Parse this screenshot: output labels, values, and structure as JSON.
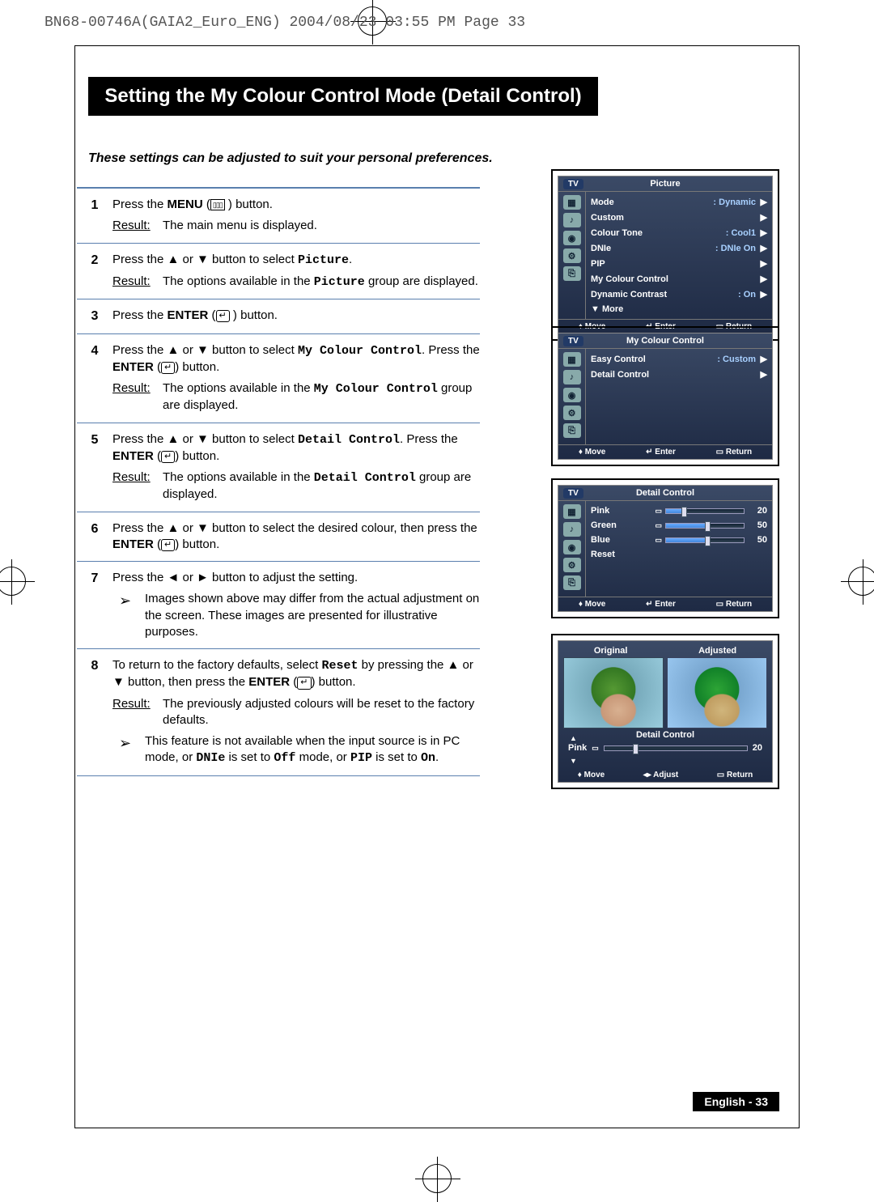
{
  "header_line": "BN68-00746A(GAIA2_Euro_ENG)  2004/08/23  03:55 PM  Page 33",
  "title": "Setting the My Colour Control Mode (Detail Control)",
  "intro": "These settings can be adjusted to suit your personal preferences.",
  "result_label": "Result:",
  "steps": {
    "1": {
      "n": "1",
      "text_a": "Press the ",
      "bold": "MENU",
      "text_b": " (",
      "text_c": " ) button.",
      "result": "The main menu is displayed."
    },
    "2": {
      "n": "2",
      "text_a": "Press the ▲ or ▼ button to select ",
      "mono": "Picture",
      "text_b": ".",
      "result_a": "The options available in the ",
      "result_mono": "Picture",
      "result_b": " group are displayed."
    },
    "3": {
      "n": "3",
      "text_a": "Press the ",
      "bold": "ENTER",
      "text_b": " (",
      "text_c": " ) button."
    },
    "4": {
      "n": "4",
      "text_a": "Press the ▲ or ▼ button to select ",
      "mono": "My Colour Control",
      "text_b": ". Press the ",
      "bold": "ENTER",
      "text_c": " (",
      "text_d": ") button.",
      "result_a": "The options available in the ",
      "result_mono": "My Colour Control",
      "result_b": " group are displayed."
    },
    "5": {
      "n": "5",
      "text_a": "Press the ▲ or ▼ button to select ",
      "mono": "Detail Control",
      "text_b": ". Press the ",
      "bold": "ENTER",
      "text_c": " (",
      "text_d": ") button.",
      "result_a": "The options available in the ",
      "result_mono": "Detail Control",
      "result_b": " group are displayed."
    },
    "6": {
      "n": "6",
      "text": "Press the ▲ or ▼ button to select the desired colour, then press the ",
      "bold": "ENTER",
      "text_b": " (",
      "text_c": ") button."
    },
    "7": {
      "n": "7",
      "text": "Press the ◄ or ► button to adjust the setting.",
      "note": "Images shown above may differ from the actual adjustment on the screen. These images are presented for illustrative purposes."
    },
    "8": {
      "n": "8",
      "text_a": "To return to the factory defaults, select ",
      "mono": "Reset",
      "text_b": "  by pressing the ▲ or ▼  button, then press the ",
      "bold": "ENTER",
      "text_c": " (",
      "text_d": ")  button.",
      "result": "The previously adjusted colours will be reset to the factory defaults.",
      "note_a": "This feature is not available when the input source is in PC mode, or ",
      "note_m1": "DNIe",
      "note_b": " is set to ",
      "note_m2": "Off",
      "note_c": " mode, or ",
      "note_m3": "PIP",
      "note_d": " is set to ",
      "note_m4": "On",
      "note_e": "."
    }
  },
  "osd": {
    "tv": "TV",
    "foot": {
      "move": "Move",
      "enter": "Enter",
      "ret": "Return",
      "adjust": "Adjust"
    },
    "picture": {
      "title": "Picture",
      "rows": [
        {
          "lbl": "Mode",
          "val": ": Dynamic"
        },
        {
          "lbl": "Custom",
          "val": ""
        },
        {
          "lbl": "Colour Tone",
          "val": ": Cool1"
        },
        {
          "lbl": "DNIe",
          "val": ": DNIe On"
        },
        {
          "lbl": "PIP",
          "val": ""
        },
        {
          "lbl": "My Colour Control",
          "val": ""
        },
        {
          "lbl": "Dynamic Contrast",
          "val": ": On"
        }
      ],
      "more": "More"
    },
    "mcc": {
      "title": "My Colour Control",
      "rows": [
        {
          "lbl": "Easy Control",
          "val": ": Custom"
        },
        {
          "lbl": "Detail Control",
          "val": ""
        }
      ]
    },
    "detail": {
      "title": "Detail Control",
      "rows": [
        {
          "lbl": "Pink",
          "val": 20
        },
        {
          "lbl": "Green",
          "val": 50
        },
        {
          "lbl": "Blue",
          "val": 50
        },
        {
          "lbl": "Reset",
          "val": null
        }
      ]
    },
    "compare": {
      "orig": "Original",
      "adj": "Adjusted",
      "mid": "Detail Control",
      "slider_lbl": "Pink",
      "slider_val": 20
    }
  },
  "page_num": "English - 33"
}
